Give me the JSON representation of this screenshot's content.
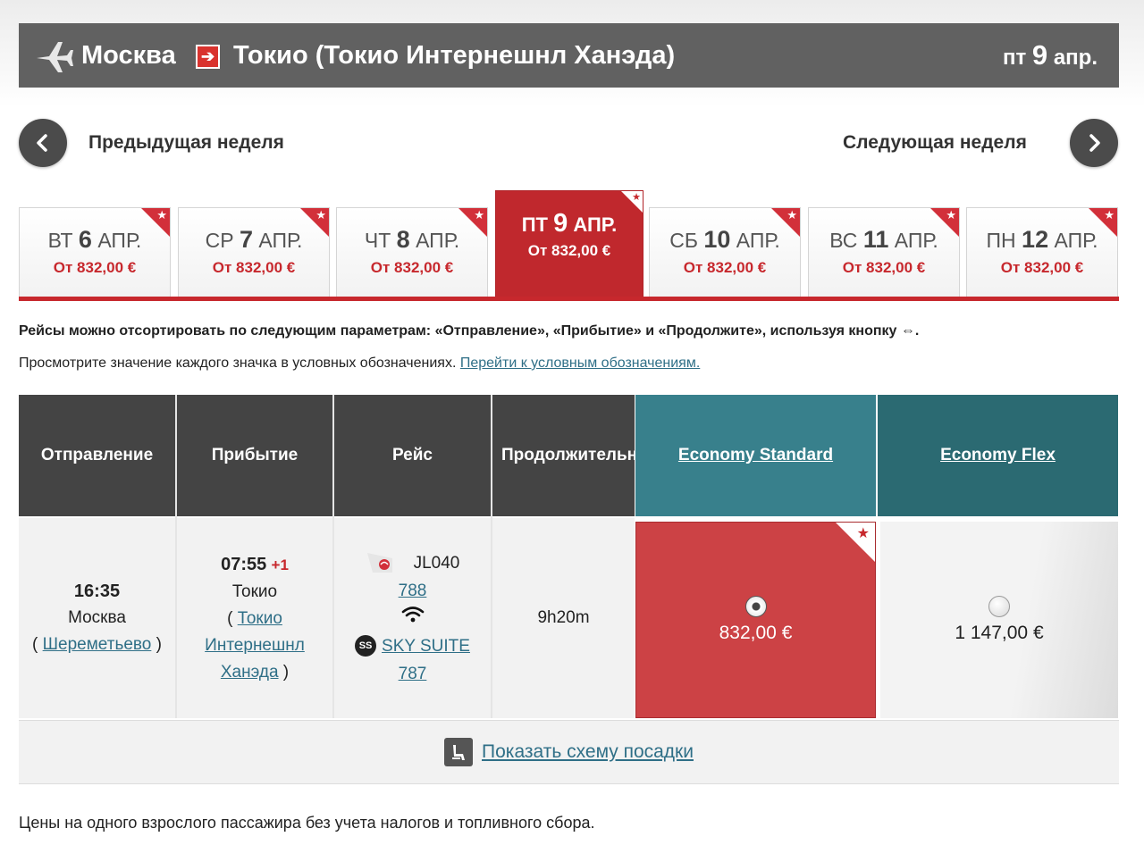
{
  "route": {
    "from": "Москва",
    "arrow": "➔",
    "to": "Токио (Токио Интернешнл Ханэда)",
    "date_prefix": "пт",
    "date_num": "9",
    "date_suffix": "апр."
  },
  "week_nav": {
    "prev_label": "Предыдущая неделя",
    "next_label": "Следующая неделя"
  },
  "date_tabs": [
    {
      "wd": "ВТ",
      "num": "6",
      "mon": "АПР.",
      "price": "От 832,00 €"
    },
    {
      "wd": "СР",
      "num": "7",
      "mon": "АПР.",
      "price": "От 832,00 €"
    },
    {
      "wd": "ЧТ",
      "num": "8",
      "mon": "АПР.",
      "price": "От 832,00 €"
    },
    {
      "wd": "ПТ",
      "num": "9",
      "mon": "АПР.",
      "price": "От 832,00 €",
      "selected": true
    },
    {
      "wd": "СБ",
      "num": "10",
      "mon": "АПР.",
      "price": "От 832,00 €"
    },
    {
      "wd": "ВС",
      "num": "11",
      "mon": "АПР.",
      "price": "От 832,00 €"
    },
    {
      "wd": "ПН",
      "num": "12",
      "mon": "АПР.",
      "price": "От 832,00 €"
    }
  ],
  "info": {
    "sort_text": "Рейсы можно отсортировать по следующим параметрам: «Отправление», «Прибытие» и «Продолжите», используя кнопку ⇔.",
    "legend_text": "Просмотрите значение каждого значка в условных обозначениях. ",
    "legend_link": "Перейти к условным обозначениям."
  },
  "table": {
    "headers": {
      "departure": "Отправление",
      "arrival": "Прибытие",
      "flight": "Рейс",
      "duration": "Продолжительность",
      "fare1": "Economy Standard",
      "fare2": "Economy Flex"
    },
    "row": {
      "dep_time": "16:35",
      "dep_city": "Москва",
      "dep_airport": "Шереметьево",
      "arr_time": "07:55",
      "arr_plus": "+1",
      "arr_city": "Токио",
      "arr_airport_1": "Токио",
      "arr_airport_2": "Интернешнл",
      "arr_airport_3": "Ханэда",
      "flight_no": "JL040",
      "aircraft": "788",
      "suite_badge": "SS",
      "suite_name": "SKY SUITE",
      "suite_aircraft": "787",
      "duration": "9h20m",
      "fare1_price": "832,00 €",
      "fare2_price": "1 147,00 €"
    }
  },
  "seatmap": {
    "label": "Показать схему посадки"
  },
  "footer": {
    "note": "Цены на одного взрослого пассажира без учета налогов и топливного сбора."
  },
  "icons": [
    "plane-icon",
    "route-arrow-icon",
    "chevron-left-icon",
    "chevron-right-icon",
    "star-icon",
    "airline-logo-icon",
    "wifi-icon",
    "seat-icon"
  ],
  "colors": {
    "accent_red": "#c7282d",
    "header_gray": "#616161",
    "fare_teal": "#38808c",
    "fare_teal_dark": "#2b6a72",
    "link_blue": "#2f6f87"
  }
}
